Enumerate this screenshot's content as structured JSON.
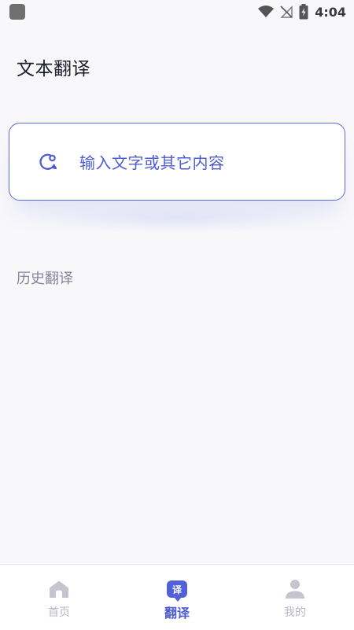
{
  "status_bar": {
    "time": "4:04",
    "icons": [
      "notification-icon",
      "wifi-icon",
      "no-signal-icon",
      "battery-charging-icon"
    ]
  },
  "page": {
    "title": "文本翻译"
  },
  "input_card": {
    "placeholder": "输入文字或其它内容",
    "icon": "chat-bubble-icon"
  },
  "history": {
    "title": "历史翻译"
  },
  "tab_bar": {
    "items": [
      {
        "label": "首页",
        "icon": "home-icon",
        "active": false
      },
      {
        "label": "翻译",
        "icon": "translate-icon",
        "badge": "译",
        "active": true
      },
      {
        "label": "我的",
        "icon": "user-icon",
        "active": false
      }
    ]
  },
  "colors": {
    "accent": "#5361d9",
    "background": "#f8f8fa",
    "inactive_tab": "#b7b8c2"
  }
}
